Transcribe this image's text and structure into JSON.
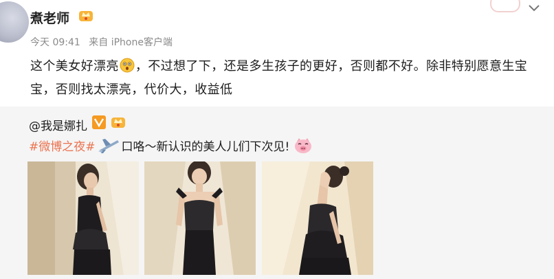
{
  "post": {
    "author": "煮老师",
    "time": "今天 09:41",
    "source": "来自 iPhone客户端",
    "text_part1": "这个美女好漂亮",
    "text_part2": "，不过想了下，还是多生孩子的更好，否则都不好。除非特别愿意生宝宝，否则找太漂亮，代价大，收益低"
  },
  "repost": {
    "author": "@我是娜扎",
    "hashtag": "#微博之夜#",
    "text": "口咯～新认识的美人儿们下次见!",
    "photos": [
      {
        "icon": "photo-dress-side"
      },
      {
        "icon": "photo-dress-front"
      },
      {
        "icon": "photo-dress-profile"
      }
    ]
  },
  "colors": {
    "hashtag": "#eb7350",
    "repost_bg": "#f5f5f5",
    "meta_text": "#8a8a8a"
  }
}
